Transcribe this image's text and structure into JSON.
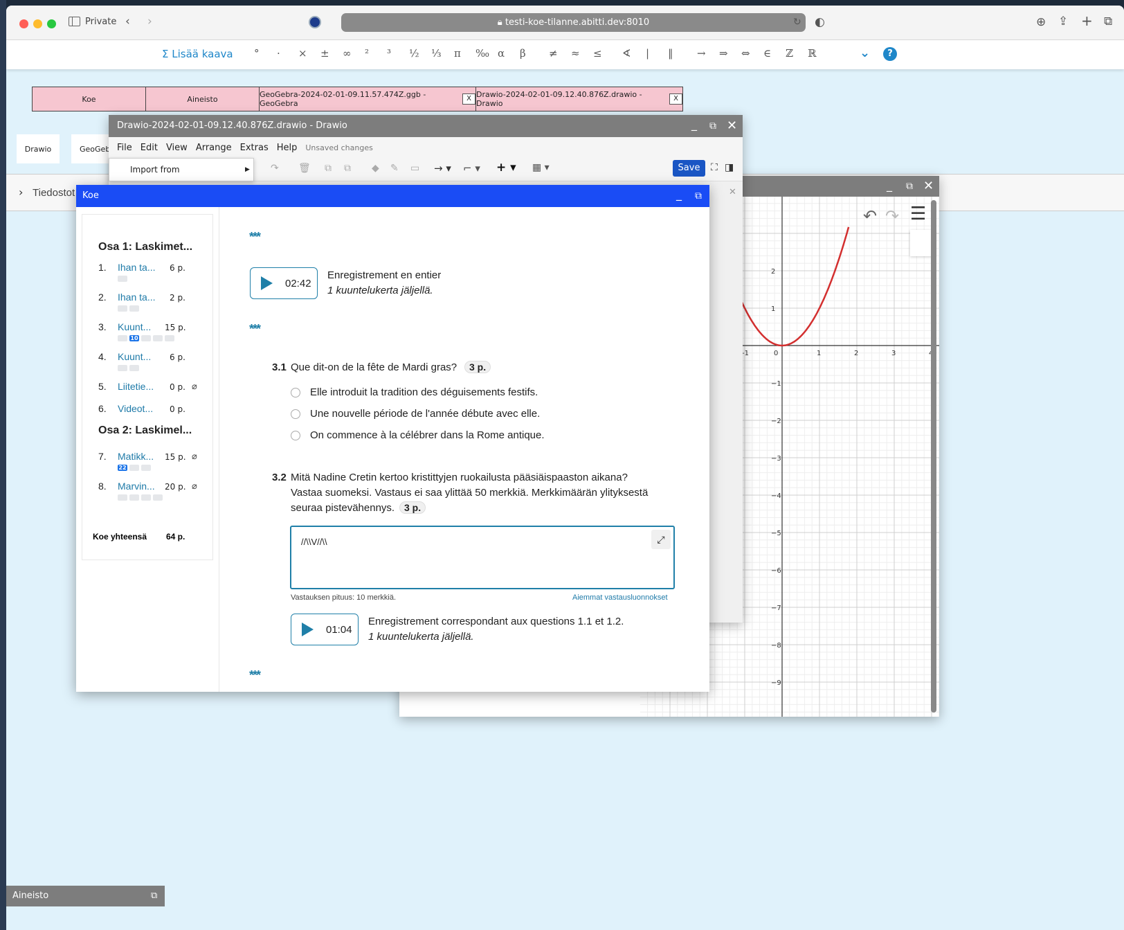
{
  "browser": {
    "private_label": "Private",
    "url": "testi-koe-tilanne.abitti.dev:8010"
  },
  "mathbar": {
    "add_formula": "Σ Lisää kaava",
    "symbols": [
      "°",
      "·",
      "×",
      "±",
      "∞",
      "²",
      "³",
      "½",
      "⅓",
      "π",
      "‰",
      "α",
      "β",
      "≠",
      "≈",
      "≤",
      "∢",
      "|",
      "‖",
      "→",
      "⇒",
      "⇔",
      "∈",
      "ℤ",
      "ℝ"
    ]
  },
  "tabs": [
    {
      "label": "Koe",
      "closable": false
    },
    {
      "label": "Aineisto",
      "closable": false
    },
    {
      "label": "GeoGebra-2024-02-01-09.11.57.474Z.ggb - GeoGebra",
      "closable": true
    },
    {
      "label": "Drawio-2024-02-01-09.12.40.876Z.drawio - Drawio",
      "closable": true
    }
  ],
  "tab_close_label": "X",
  "small_tabs": {
    "drawio": "Drawio",
    "geogebra": "GeoGeb"
  },
  "tiedostot": "Tiedostot",
  "drawio": {
    "title": "Drawio-2024-02-01-09.12.40.876Z.drawio - Drawio",
    "menu": [
      "File",
      "Edit",
      "View",
      "Arrange",
      "Extras",
      "Help"
    ],
    "unsaved": "Unsaved changes",
    "save": "Save",
    "import_from": "Import from"
  },
  "geogebra": {
    "x_ticks": [
      "-1",
      "0",
      "1",
      "2",
      "3",
      "4"
    ],
    "y_ticks": [
      "2",
      "1",
      "−1",
      "−2",
      "−3",
      "−4",
      "−5",
      "−6",
      "−7",
      "−8",
      "−9"
    ]
  },
  "koe": {
    "title": "Koe",
    "sections": [
      {
        "title": "Osa 1: Laskimet...",
        "questions": [
          {
            "num": "1.",
            "label": "Ihan ta...",
            "points": "6 p.",
            "dots": [
              ""
            ],
            "attachment": false
          },
          {
            "num": "2.",
            "label": "Ihan ta...",
            "points": "2 p.",
            "dots": [
              "",
              ""
            ],
            "attachment": false
          },
          {
            "num": "3.",
            "label": "Kuunt...",
            "points": "15 p.",
            "dots": [
              "",
              "10",
              "",
              "",
              ""
            ],
            "attachment": false
          },
          {
            "num": "4.",
            "label": "Kuunt...",
            "points": "6 p.",
            "dots": [
              "",
              ""
            ],
            "attachment": false
          },
          {
            "num": "5.",
            "label": "Liitetie...",
            "points": "0 p.",
            "dots": [],
            "attachment": true
          },
          {
            "num": "6.",
            "label": "Videot...",
            "points": "0 p.",
            "dots": [],
            "attachment": false
          }
        ]
      },
      {
        "title": "Osa 2: Laskimel...",
        "questions": [
          {
            "num": "7.",
            "label": "Matikk...",
            "points": "15 p.",
            "dots": [
              "22",
              "",
              ""
            ],
            "attachment": true
          },
          {
            "num": "8.",
            "label": "Marvin...",
            "points": "20 p.",
            "dots": [
              "",
              "",
              "",
              ""
            ],
            "attachment": true
          }
        ]
      }
    ],
    "total_label": "Koe yhteensä",
    "total_points": "64 p.",
    "stars": "***",
    "audio1": {
      "time": "02:42",
      "title": "Enregistrement en entier",
      "remaining": "1 kuuntelukerta jäljellä."
    },
    "q31": {
      "num": "3.1",
      "text": "Que dit-on de la fête de Mardi gras?",
      "points": "3 p.",
      "options": [
        "Elle introduit la tradition des déguisements festifs.",
        "Une nouvelle période de l'année débute avec elle.",
        "On commence à la célébrer dans la Rome antique."
      ]
    },
    "q32": {
      "num": "3.2",
      "line1": "Mitä Nadine Cretin kertoo kristittyjen ruokailusta pääsiäispaaston aikana?",
      "line2": "Vastaa suomeksi. Vastaus ei saa ylittää 50 merkkiä. Merkkimäärän ylityksestä",
      "line3": "seuraa pistevähennys.",
      "points": "3 p.",
      "answer": "//\\\\V//\\\\",
      "length_info": "Vastauksen pituus: 10 merkkiä.",
      "drafts_link": "Aiemmat vastausluonnokset"
    },
    "audio2": {
      "time": "01:04",
      "title": "Enregistrement correspondant aux questions 1.1 et 1.2.",
      "remaining": "1 kuuntelukerta jäljellä."
    }
  },
  "aineisto_bar": "Aineisto"
}
